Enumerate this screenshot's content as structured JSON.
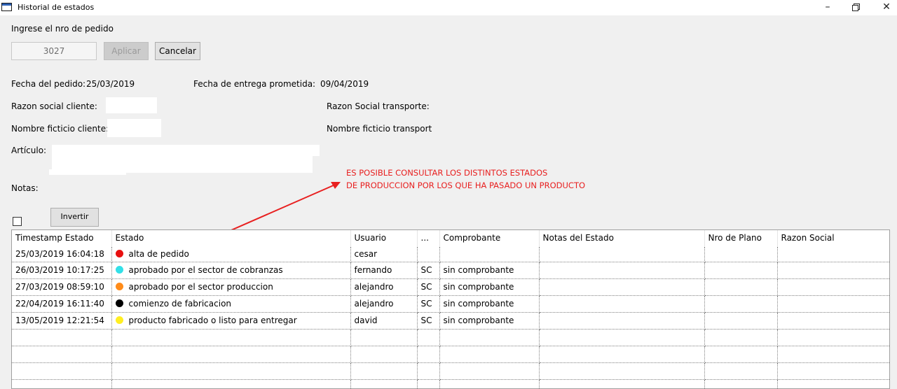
{
  "window": {
    "title": "Historial de estados"
  },
  "form": {
    "order_prompt": "Ingrese el nro de pedido",
    "order_value": "3027",
    "apply_label": "Aplicar",
    "cancel_label": "Cancelar",
    "fecha_pedido_label": "Fecha del pedido:",
    "fecha_pedido_value": "25/03/2019",
    "fecha_entrega_label": "Fecha de entrega prometida:",
    "fecha_entrega_value": "09/04/2019",
    "razon_social_cliente_label": "Razon social cliente:",
    "razon_social_transporte_label": "Razon Social transporte:",
    "nombre_ficticio_cliente_label": "Nombre ficticio cliente:",
    "nombre_ficticio_transport_label": "Nombre ficticio transport",
    "articulo_label": "Artículo:",
    "notas_label": "Notas:",
    "invertir_label": "Invertir"
  },
  "annotation": {
    "line1": "ES POSIBLE CONSULTAR LOS DISTINTOS ESTADOS",
    "line2": "DE PRODUCCION POR LOS QUE HA PASADO UN PRODUCTO",
    "color": "#e82020"
  },
  "grid": {
    "columns": [
      "Timestamp Estado",
      "Estado",
      "Usuario",
      "...",
      "Comprobante",
      "Notas del Estado",
      "Nro de Plano",
      "Razon Social"
    ],
    "rows": [
      {
        "timestamp": "25/03/2019 16:04:18",
        "color": "#e81010",
        "estado": "alta de pedido",
        "usuario": "cesar",
        "code": "",
        "comprobante": "",
        "notas": "",
        "plano": "",
        "razon": ""
      },
      {
        "timestamp": "26/03/2019 10:17:25",
        "color": "#33e0e8",
        "estado": "aprobado por el sector de cobranzas",
        "usuario": "fernando",
        "code": "SC",
        "comprobante": "sin comprobante",
        "notas": "",
        "plano": "",
        "razon": ""
      },
      {
        "timestamp": "27/03/2019 08:59:10",
        "color": "#ff8c1a",
        "estado": "aprobado por el sector produccion",
        "usuario": "alejandro",
        "code": "SC",
        "comprobante": "sin comprobante",
        "notas": "",
        "plano": "",
        "razon": ""
      },
      {
        "timestamp": "22/04/2019 16:11:40",
        "color": "#000000",
        "estado": "comienzo de fabricacion",
        "usuario": "alejandro",
        "code": "SC",
        "comprobante": "sin comprobante",
        "notas": "",
        "plano": "",
        "razon": ""
      },
      {
        "timestamp": "13/05/2019 12:21:54",
        "color": "#ffee22",
        "estado": "producto fabricado o listo para entregar",
        "usuario": "david",
        "code": "SC",
        "comprobante": "sin comprobante",
        "notas": "",
        "plano": "",
        "razon": ""
      }
    ]
  }
}
